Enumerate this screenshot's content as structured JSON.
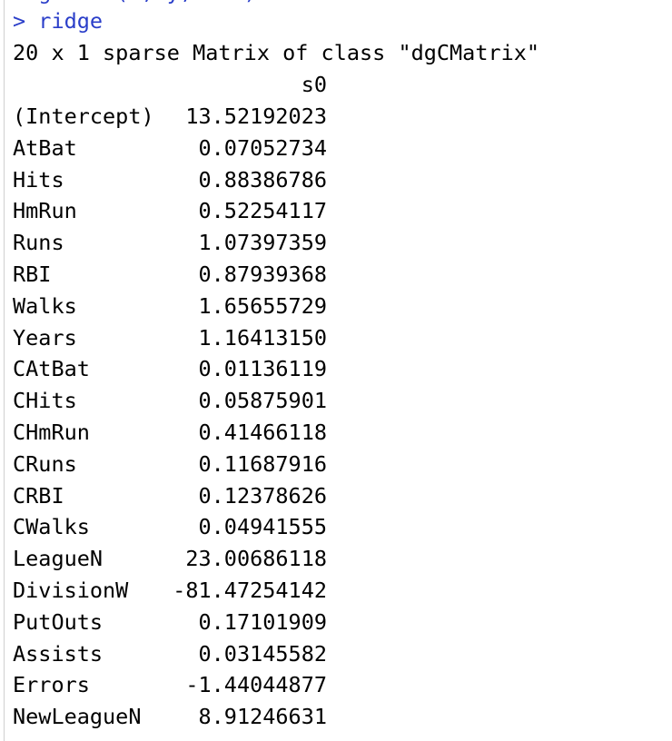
{
  "console": {
    "prev_line": "> glmnet(x, y, ...)",
    "prompt": "> ridge",
    "title_line": "20 x 1 sparse Matrix of class \"dgCMatrix\"",
    "column_header": "s0",
    "rows": [
      {
        "name": "(Intercept)",
        "value": "13.52192023"
      },
      {
        "name": "AtBat",
        "value": "0.07052734"
      },
      {
        "name": "Hits",
        "value": "0.88386786"
      },
      {
        "name": "HmRun",
        "value": "0.52254117"
      },
      {
        "name": "Runs",
        "value": "1.07397359"
      },
      {
        "name": "RBI",
        "value": "0.87939368"
      },
      {
        "name": "Walks",
        "value": "1.65655729"
      },
      {
        "name": "Years",
        "value": "1.16413150"
      },
      {
        "name": "CAtBat",
        "value": "0.01136119"
      },
      {
        "name": "CHits",
        "value": "0.05875901"
      },
      {
        "name": "CHmRun",
        "value": "0.41466118"
      },
      {
        "name": "CRuns",
        "value": "0.11687916"
      },
      {
        "name": "CRBI",
        "value": "0.12378626"
      },
      {
        "name": "CWalks",
        "value": "0.04941555"
      },
      {
        "name": "LeagueN",
        "value": "23.00686118"
      },
      {
        "name": "DivisionW",
        "value": "-81.47254142"
      },
      {
        "name": "PutOuts",
        "value": "0.17101909"
      },
      {
        "name": "Assists",
        "value": "0.03145582"
      },
      {
        "name": "Errors",
        "value": "-1.44044877"
      },
      {
        "name": "NewLeagueN",
        "value": "8.91246631"
      }
    ]
  },
  "colors": {
    "command": "#2a3ec9",
    "text": "#000000",
    "background": "#ffffff"
  }
}
